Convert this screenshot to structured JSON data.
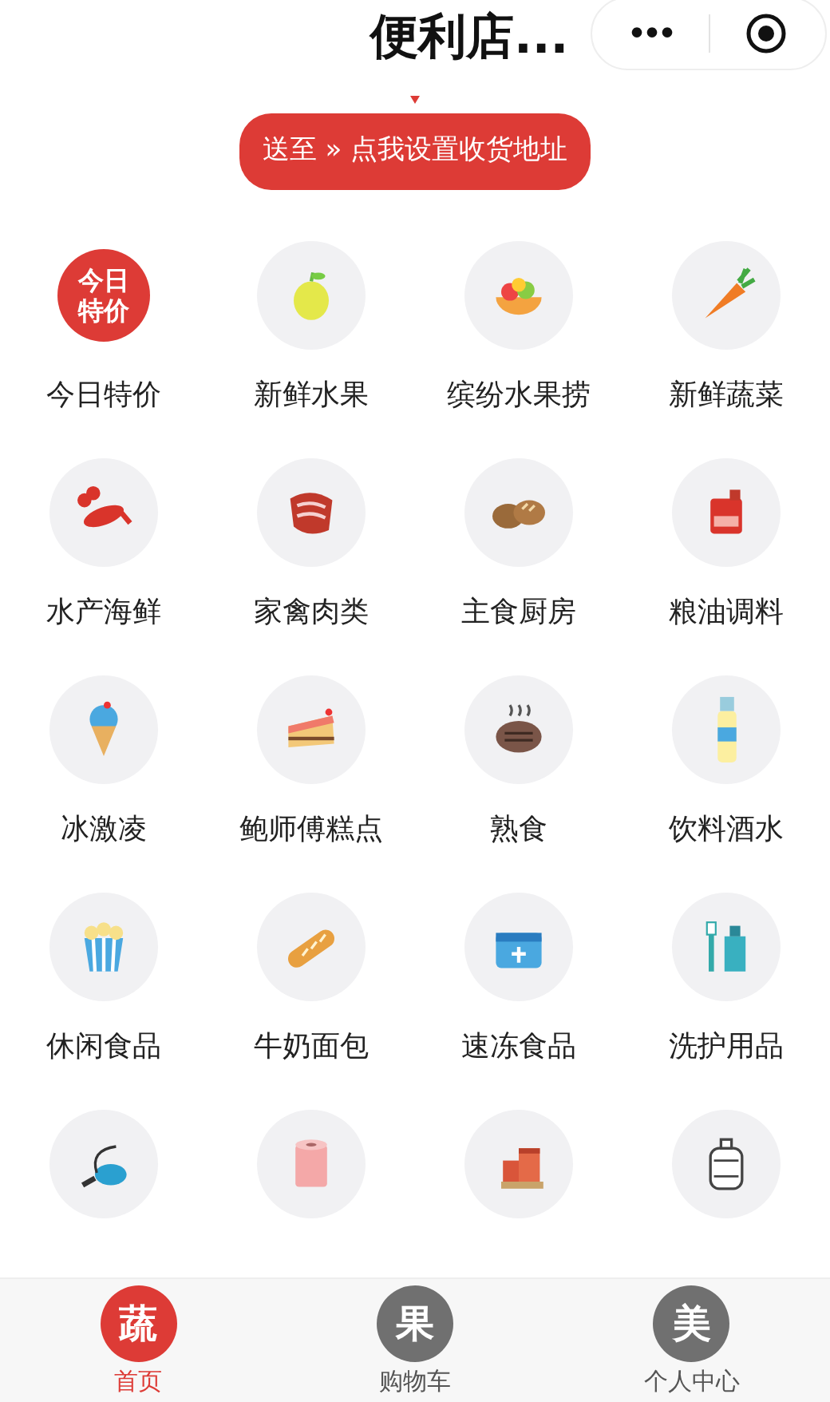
{
  "header": {
    "title": "便利店...",
    "more": "•••"
  },
  "address_banner": {
    "text": "送至 » 点我设置收货地址"
  },
  "categories": [
    {
      "kind": "badge",
      "badge_text": "今日特价",
      "label": "今日特价"
    },
    {
      "kind": "icon",
      "label": "新鲜水果"
    },
    {
      "kind": "icon",
      "label": "缤纷水果捞"
    },
    {
      "kind": "icon",
      "label": "新鲜蔬菜"
    },
    {
      "kind": "icon",
      "label": "水产海鲜"
    },
    {
      "kind": "icon",
      "label": "家禽肉类"
    },
    {
      "kind": "icon",
      "label": "主食厨房"
    },
    {
      "kind": "icon",
      "label": "粮油调料"
    },
    {
      "kind": "icon",
      "label": "冰激凌"
    },
    {
      "kind": "icon",
      "label": "鲍师傅糕点"
    },
    {
      "kind": "icon",
      "label": "熟食"
    },
    {
      "kind": "icon",
      "label": "饮料酒水"
    },
    {
      "kind": "icon",
      "label": "休闲食品"
    },
    {
      "kind": "icon",
      "label": "牛奶面包"
    },
    {
      "kind": "icon",
      "label": "速冻食品"
    },
    {
      "kind": "icon",
      "label": "洗护用品"
    },
    {
      "kind": "icon"
    },
    {
      "kind": "icon"
    },
    {
      "kind": "icon"
    },
    {
      "kind": "icon"
    }
  ],
  "tab_bar": [
    {
      "glyph": "蔬",
      "label": "首页",
      "selected": true
    },
    {
      "glyph": "果",
      "label": "购物车",
      "selected": false
    },
    {
      "glyph": "美",
      "label": "个人中心",
      "selected": false
    }
  ]
}
